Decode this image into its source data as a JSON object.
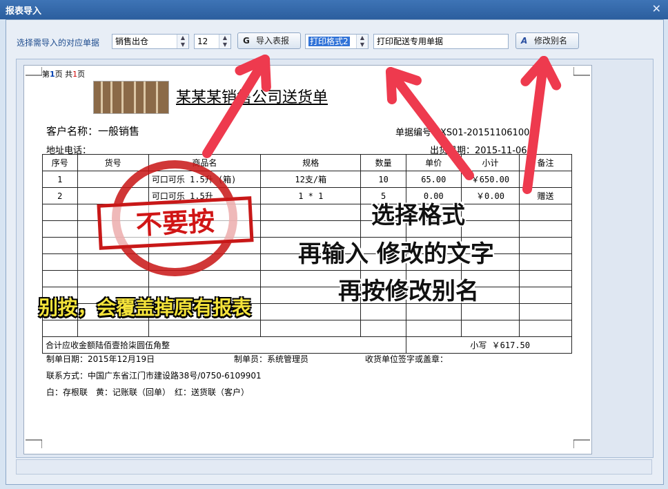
{
  "window": {
    "title": "报表导入",
    "close_glyph": "✕"
  },
  "toolbar": {
    "label": "选择需导入的对应单据",
    "doc_type": "销售出仓",
    "number": "12",
    "import_button": "导入表报",
    "format_select": "打印格式2",
    "alias_input": "打印配送专用单据",
    "rename_button": "修改别名"
  },
  "page": {
    "page_prefix": "第",
    "page_no": "1",
    "page_mid": "页 共",
    "page_total": "1",
    "page_suffix": "页",
    "title": "某某某销售公司送货单",
    "customer": "客户名称：一般销售",
    "doc_no": "单据编号：XS01-201511061001",
    "address": "地址电话：",
    "date": "出货日期：2015-11-06",
    "headers": [
      "序号",
      "货号",
      "商品名",
      "规格",
      "数量",
      "单价",
      "小计",
      "备注"
    ],
    "rows": [
      [
        "1",
        "",
        "可口可乐 1.5升 (箱)",
        "12支/箱",
        "10",
        "65.00",
        "￥650.00",
        ""
      ],
      [
        "2",
        "",
        "可口可乐 1.5升",
        "1 * 1",
        "5",
        "0.00",
        "￥0.00",
        "赠送"
      ]
    ],
    "total_words": "合计应收金额陆佰壹拾柒圆伍角整",
    "total_small": "小写 ￥617.50",
    "made_date": "制单日期：2015年12月19日",
    "maker": "制单员：系统管理员",
    "sign": "收货单位签字或盖章：",
    "contact": "联系方式：中国广东省江门市建设路38号/0750-6109901",
    "copies": "白：存根联　黄：记账联（回单）　红：送货联（客户）"
  },
  "overlay": {
    "stamp": "不要按",
    "warning": "别按，会覆盖掉原有报表",
    "note_lines": [
      "选择格式",
      "再输入 修改的文字",
      "再按修改别名"
    ],
    "arrow_color": "#ee3a4e"
  }
}
